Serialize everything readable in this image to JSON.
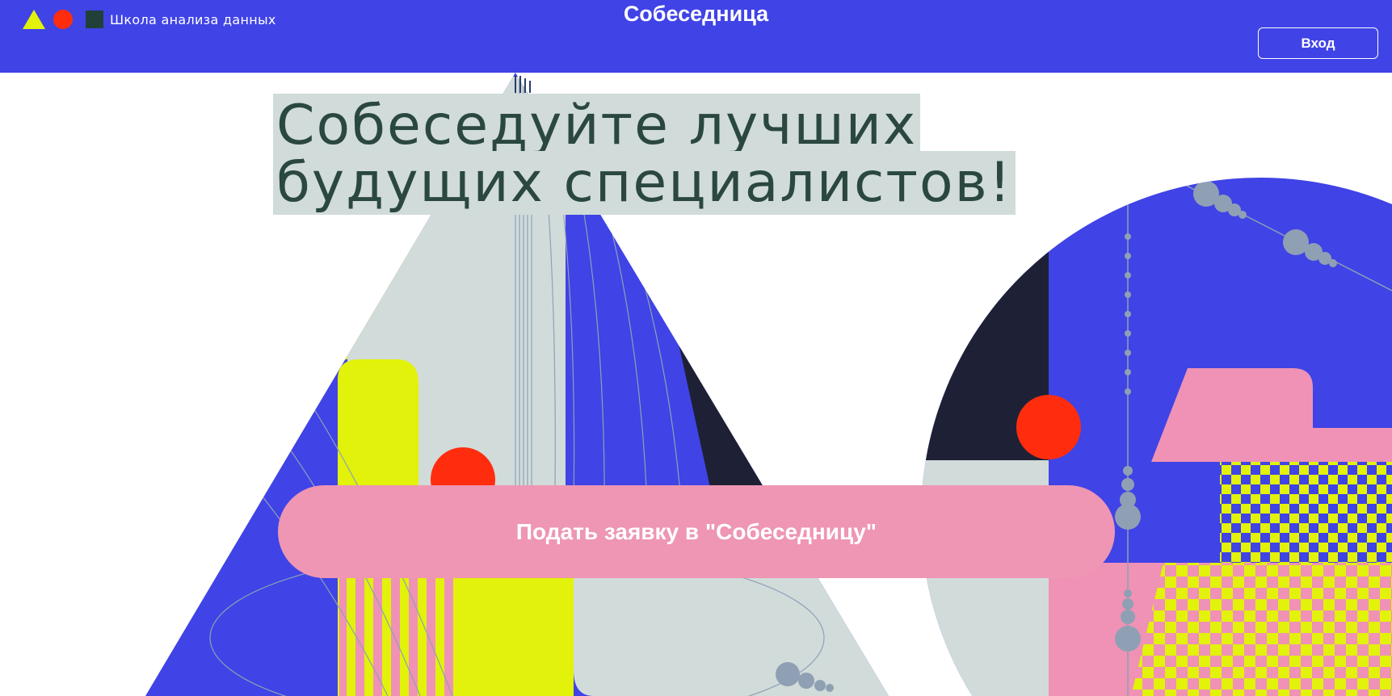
{
  "header": {
    "logo_text": "Школа анализа данных",
    "site_title": "Собеседница",
    "login_label": "Вход"
  },
  "hero": {
    "headline_line1": "Собеседуйте лучших",
    "headline_line2": "будущих специалистов!",
    "cta_label": "Подать заявку в \"Собеседницу\""
  },
  "colors": {
    "header_bg": "#4043e6",
    "accent_yellow": "#e2f20a",
    "accent_red": "#ff2d0e",
    "accent_pink": "#ee96b4",
    "headline_text": "#2a4740",
    "headline_bg": "#d1dbda",
    "dark_navy": "#1e2135",
    "light_gray": "#d1dbda"
  }
}
